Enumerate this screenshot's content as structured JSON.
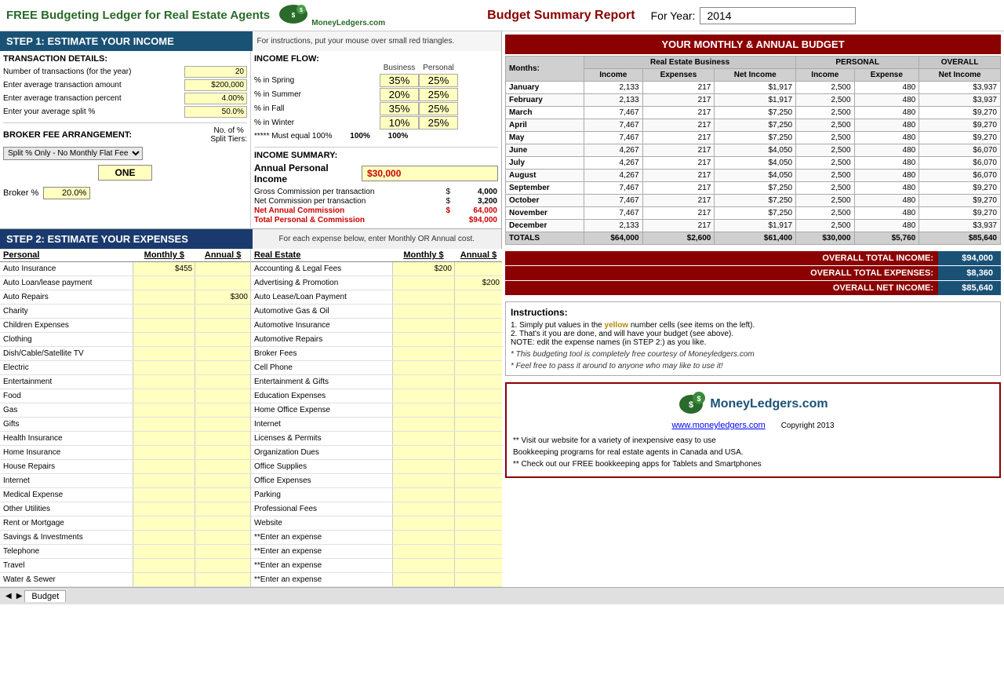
{
  "header": {
    "title": "FREE Budgeting Ledger for Real Estate Agents",
    "budget_title": "Budget Summary Report",
    "year_label": "For Year:",
    "year": "2014"
  },
  "step1": {
    "header": "STEP 1:  ESTIMATE YOUR INCOME",
    "hint": "For instructions, put your mouse over small red triangles.",
    "transaction": {
      "title": "TRANSACTION DETAILS:",
      "rows": [
        {
          "label": "Number of transactions (for the year)",
          "value": "20"
        },
        {
          "label": "Enter average transaction amount",
          "value": "$200,000"
        },
        {
          "label": "Enter average transaction percent",
          "value": "4.00%"
        },
        {
          "label": "Enter your average split %",
          "value": "50.0%"
        }
      ]
    },
    "broker": {
      "title": "BROKER FEE ARRANGEMENT:",
      "no_label": "No. of %",
      "split_label": "Split Tiers:",
      "selected": "Split % Only - No Monthly Flat Fee",
      "one": "ONE",
      "broker_pct_label": "Broker %",
      "broker_pct_value": "20.0%"
    },
    "income_flow": {
      "title": "INCOME FLOW:",
      "col_business": "Business",
      "col_personal": "Personal",
      "rows": [
        {
          "label": "% in Spring",
          "business": "35%",
          "personal": "25%"
        },
        {
          "label": "% in Summer",
          "business": "20%",
          "personal": "25%"
        },
        {
          "label": "% in Fall",
          "business": "35%",
          "personal": "25%"
        },
        {
          "label": "% in Winter",
          "business": "10%",
          "personal": "25%"
        }
      ],
      "must_equal": "***** Must equal 100%",
      "totals": {
        "business": "100%",
        "personal": "100%"
      }
    },
    "income_summary": {
      "title": "INCOME SUMMARY:",
      "annual_label": "Annual Personal Income",
      "annual_value": "$30,000",
      "calcs": [
        {
          "label": "Gross Commission per transaction",
          "symbol": "$",
          "amount": "4,000"
        },
        {
          "label": "Net Commission per transaction",
          "symbol": "$",
          "amount": "3,200"
        },
        {
          "label": "Net Annual Commission",
          "symbol": "$",
          "amount": "64,000"
        },
        {
          "label": "Total Personal & Commission",
          "symbol": "",
          "amount": "$94,000"
        }
      ]
    }
  },
  "step2": {
    "header": "STEP 2: ESTIMATE YOUR EXPENSES",
    "hint": "For each expense below, enter Monthly OR Annual cost.",
    "personal": {
      "col_label": "Personal",
      "col_monthly": "Monthly $",
      "col_annual": "Annual $",
      "expenses": [
        {
          "label": "Auto Insurance",
          "monthly": "$455",
          "annual": ""
        },
        {
          "label": "Auto Loan/lease payment",
          "monthly": "",
          "annual": ""
        },
        {
          "label": "Auto Repairs",
          "monthly": "",
          "annual": "$300"
        },
        {
          "label": "Charity",
          "monthly": "",
          "annual": ""
        },
        {
          "label": "Children Expenses",
          "monthly": "",
          "annual": ""
        },
        {
          "label": "Clothing",
          "monthly": "",
          "annual": ""
        },
        {
          "label": "Dish/Cable/Satellite TV",
          "monthly": "",
          "annual": ""
        },
        {
          "label": "Electric",
          "monthly": "",
          "annual": ""
        },
        {
          "label": "Entertainment",
          "monthly": "",
          "annual": ""
        },
        {
          "label": "Food",
          "monthly": "",
          "annual": ""
        },
        {
          "label": "Gas",
          "monthly": "",
          "annual": ""
        },
        {
          "label": "Gifts",
          "monthly": "",
          "annual": ""
        },
        {
          "label": "Health Insurance",
          "monthly": "",
          "annual": ""
        },
        {
          "label": "Home Insurance",
          "monthly": "",
          "annual": ""
        },
        {
          "label": "House Repairs",
          "monthly": "",
          "annual": ""
        },
        {
          "label": "Internet",
          "monthly": "",
          "annual": ""
        },
        {
          "label": "Medical Expense",
          "monthly": "",
          "annual": ""
        },
        {
          "label": "Other Utilities",
          "monthly": "",
          "annual": ""
        },
        {
          "label": "Rent or Mortgage",
          "monthly": "",
          "annual": ""
        },
        {
          "label": "Savings & Investments",
          "monthly": "",
          "annual": ""
        },
        {
          "label": "Telephone",
          "monthly": "",
          "annual": ""
        },
        {
          "label": "Travel",
          "monthly": "",
          "annual": ""
        },
        {
          "label": "Water & Sewer",
          "monthly": "",
          "annual": ""
        }
      ]
    },
    "realestate": {
      "col_label": "Real Estate",
      "col_monthly": "Monthly $",
      "col_annual": "Annual $",
      "expenses": [
        {
          "label": "Accounting & Legal Fees",
          "monthly": "",
          "annual": ""
        },
        {
          "label": "Advertising & Promotion",
          "monthly": "",
          "annual": "$200"
        },
        {
          "label": "Auto Lease/Loan Payment",
          "monthly": "",
          "annual": ""
        },
        {
          "label": "Automotive Gas & Oil",
          "monthly": "",
          "annual": ""
        },
        {
          "label": "Automotive Insurance",
          "monthly": "",
          "annual": ""
        },
        {
          "label": "Automotive Repairs",
          "monthly": "",
          "annual": ""
        },
        {
          "label": "Broker Fees",
          "monthly": "",
          "annual": ""
        },
        {
          "label": "Cell Phone",
          "monthly": "",
          "annual": ""
        },
        {
          "label": "Entertainment & Gifts",
          "monthly": "",
          "annual": ""
        },
        {
          "label": "Education Expenses",
          "monthly": "",
          "annual": ""
        },
        {
          "label": "Home Office Expense",
          "monthly": "",
          "annual": ""
        },
        {
          "label": "Internet",
          "monthly": "",
          "annual": ""
        },
        {
          "label": "Licenses & Permits",
          "monthly": "",
          "annual": ""
        },
        {
          "label": "Organization Dues",
          "monthly": "",
          "annual": ""
        },
        {
          "label": "Office Supplies",
          "monthly": "",
          "annual": ""
        },
        {
          "label": "Office Expenses",
          "monthly": "",
          "annual": ""
        },
        {
          "label": "Parking",
          "monthly": "",
          "annual": ""
        },
        {
          "label": "Professional Fees",
          "monthly": "",
          "annual": ""
        },
        {
          "label": "Website",
          "monthly": "",
          "annual": ""
        },
        {
          "label": "**Enter an expense",
          "monthly": "",
          "annual": ""
        },
        {
          "label": "**Enter an expense",
          "monthly": "",
          "annual": ""
        },
        {
          "label": "**Enter an expense",
          "monthly": "",
          "annual": ""
        },
        {
          "label": "**Enter an expense",
          "monthly": "",
          "annual": ""
        }
      ]
    }
  },
  "budget_table": {
    "title": "YOUR MONTHLY & ANNUAL BUDGET",
    "re_group": "Real Estate Business",
    "per_group": "PERSONAL",
    "overall_group": "OVERALL",
    "col_months": "Months:",
    "col_re_income": "Income",
    "col_re_expenses": "Expenses",
    "col_re_net": "Net Income",
    "col_per_income": "Income",
    "col_per_expense": "Expense",
    "col_overall_net": "Net Income",
    "rows": [
      {
        "month": "January",
        "re_inc": "2,133",
        "re_exp": "217",
        "re_net": "$1,917",
        "per_inc": "2,500",
        "per_exp": "480",
        "net": "$3,937"
      },
      {
        "month": "February",
        "re_inc": "2,133",
        "re_exp": "217",
        "re_net": "$1,917",
        "per_inc": "2,500",
        "per_exp": "480",
        "net": "$3,937"
      },
      {
        "month": "March",
        "re_inc": "7,467",
        "re_exp": "217",
        "re_net": "$7,250",
        "per_inc": "2,500",
        "per_exp": "480",
        "net": "$9,270"
      },
      {
        "month": "April",
        "re_inc": "7,467",
        "re_exp": "217",
        "re_net": "$7,250",
        "per_inc": "2,500",
        "per_exp": "480",
        "net": "$9,270"
      },
      {
        "month": "May",
        "re_inc": "7,467",
        "re_exp": "217",
        "re_net": "$7,250",
        "per_inc": "2,500",
        "per_exp": "480",
        "net": "$9,270"
      },
      {
        "month": "June",
        "re_inc": "4,267",
        "re_exp": "217",
        "re_net": "$4,050",
        "per_inc": "2,500",
        "per_exp": "480",
        "net": "$6,070"
      },
      {
        "month": "July",
        "re_inc": "4,267",
        "re_exp": "217",
        "re_net": "$4,050",
        "per_inc": "2,500",
        "per_exp": "480",
        "net": "$6,070"
      },
      {
        "month": "August",
        "re_inc": "4,267",
        "re_exp": "217",
        "re_net": "$4,050",
        "per_inc": "2,500",
        "per_exp": "480",
        "net": "$6,070"
      },
      {
        "month": "September",
        "re_inc": "7,467",
        "re_exp": "217",
        "re_net": "$7,250",
        "per_inc": "2,500",
        "per_exp": "480",
        "net": "$9,270"
      },
      {
        "month": "October",
        "re_inc": "7,467",
        "re_exp": "217",
        "re_net": "$7,250",
        "per_inc": "2,500",
        "per_exp": "480",
        "net": "$9,270"
      },
      {
        "month": "November",
        "re_inc": "7,467",
        "re_exp": "217",
        "re_net": "$7,250",
        "per_inc": "2,500",
        "per_exp": "480",
        "net": "$9,270"
      },
      {
        "month": "December",
        "re_inc": "2,133",
        "re_exp": "217",
        "re_net": "$1,917",
        "per_inc": "2,500",
        "per_exp": "480",
        "net": "$3,937"
      }
    ],
    "totals": {
      "label": "TOTALS",
      "re_inc": "$64,000",
      "re_exp": "$2,600",
      "re_net": "$61,400",
      "per_inc": "$30,000",
      "per_exp": "$5,760",
      "net": "$85,640"
    }
  },
  "overall": {
    "total_income_label": "OVERALL TOTAL INCOME:",
    "total_income_value": "$94,000",
    "total_expenses_label": "OVERALL TOTAL EXPENSES:",
    "total_expenses_value": "$8,360",
    "net_income_label": "OVERALL NET INCOME:",
    "net_income_value": "$85,640"
  },
  "instructions": {
    "title": "Instructions:",
    "line1": "1.  Simply put values in the ",
    "line1_yellow": "yellow",
    "line1_end": " number cells (see items on the left).",
    "line2": "2.  That's it you are done, and will have your budget (see above).",
    "note": "NOTE: edit the expense names (in STEP 2:) as you like.",
    "italic1": "* This budgeting tool is completely free courtesy of Moneyledgers.com",
    "italic2": "* Feel free to pass it around to anyone who may like to use it!"
  },
  "logo": {
    "site_name": "MoneyLedgers.com",
    "url": "www.moneyledgers.com",
    "copyright": "Copyright 2013",
    "desc1": "** Visit our website for a variety of inexpensive easy to use",
    "desc2": "    Bookkeeping programs for real estate agents in Canada and USA.",
    "desc3": "",
    "desc4": "** Check out our FREE bookkeeping apps for Tablets and Smartphones"
  },
  "bottom": {
    "sheet_tab": "Budget"
  }
}
